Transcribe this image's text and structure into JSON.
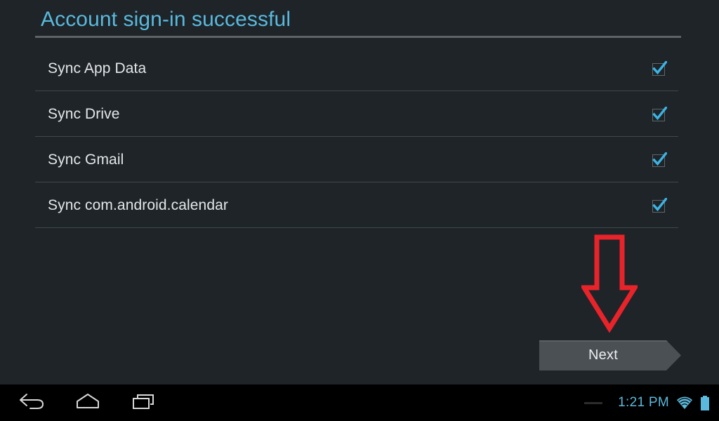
{
  "screen": {
    "background_color": "#1e2428",
    "nav_bar_color": "#000000",
    "accent_color": "#5ab9dd"
  },
  "page": {
    "title": "Account sign-in successful"
  },
  "sync_list": [
    {
      "label": "Sync App Data",
      "checked": true,
      "checkbox_name": "checkbox-sync-app-data"
    },
    {
      "label": "Sync Drive",
      "checked": true,
      "checkbox_name": "checkbox-sync-drive"
    },
    {
      "label": "Sync Gmail",
      "checked": true,
      "checkbox_name": "checkbox-sync-gmail"
    },
    {
      "label": "Sync com.android.calendar",
      "checked": true,
      "checkbox_name": "checkbox-sync-calendar"
    }
  ],
  "next_button": {
    "label": "Next",
    "fill_color": "#4b5055"
  },
  "annotation": {
    "type": "down-arrow",
    "color": "#e8232a",
    "points_to": "Next"
  },
  "nav_bar": {
    "back_label": "Back",
    "home_label": "Home",
    "recents_label": "Recent apps"
  },
  "status_bar": {
    "clock": "1:21 PM",
    "wifi": "wifi-icon",
    "battery": "battery-icon",
    "icon_color": "#5ab9dd"
  }
}
